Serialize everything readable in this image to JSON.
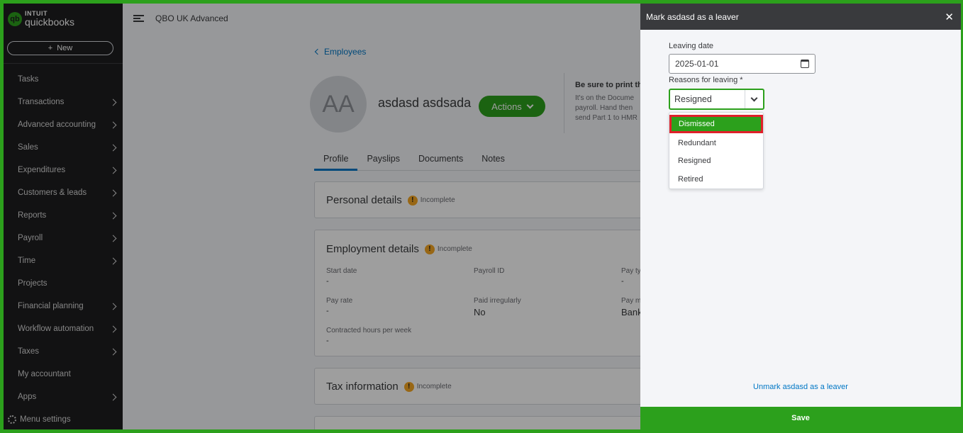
{
  "app": {
    "logo_top": "INTUIT",
    "logo_bottom": "quickbooks",
    "logo_mark": "qb",
    "company": "QBO UK Advanced",
    "new_label": "New",
    "brand_green": "#2ca01c",
    "sidebar_bg": "#1d1d1f"
  },
  "sidebar": {
    "items": [
      {
        "label": "Tasks",
        "chevron": false
      },
      {
        "label": "Transactions",
        "chevron": true
      },
      {
        "label": "Advanced accounting",
        "chevron": true
      },
      {
        "label": "Sales",
        "chevron": true
      },
      {
        "label": "Expenditures",
        "chevron": true
      },
      {
        "label": "Customers & leads",
        "chevron": true
      },
      {
        "label": "Reports",
        "chevron": true
      },
      {
        "label": "Payroll",
        "chevron": true
      },
      {
        "label": "Time",
        "chevron": true
      },
      {
        "label": "Projects",
        "chevron": false
      },
      {
        "label": "Financial planning",
        "chevron": true
      },
      {
        "label": "Workflow automation",
        "chevron": true
      },
      {
        "label": "Taxes",
        "chevron": true
      },
      {
        "label": "My accountant",
        "chevron": false
      },
      {
        "label": "Apps",
        "chevron": true
      }
    ],
    "menu_settings": "Menu settings"
  },
  "employee": {
    "back_label": "Employees",
    "initials": "AA",
    "name": "asdasd asdsada",
    "actions_label": "Actions",
    "notice_title": "Be sure to print th",
    "notice_body": "It's on the Docume\npayroll. Hand then\nsend Part 1 to HMR",
    "tabs": [
      "Profile",
      "Payslips",
      "Documents",
      "Notes"
    ],
    "active_tab": "Profile",
    "personal": {
      "title": "Personal details",
      "status": "Incomplete"
    },
    "employment": {
      "title": "Employment details",
      "status": "Incomplete",
      "start_date_label": "Start date",
      "start_date_value": "-",
      "payroll_id_label": "Payroll ID",
      "pay_type_label": "Pay ty",
      "pay_type_value": "-",
      "pay_rate_label": "Pay rate",
      "pay_rate_value": "-",
      "paid_irregularly_label": "Paid irregularly",
      "paid_irregularly_value": "No",
      "pay_method_label": "Pay m",
      "pay_method_value": "Bank",
      "contracted_label": "Contracted hours per week",
      "contracted_value": "-"
    },
    "tax": {
      "title": "Tax information",
      "status": "Incomplete"
    }
  },
  "drawer": {
    "title": "Mark asdasd as a leaver",
    "leaving_date_label": "Leaving date",
    "leaving_date_value": "2025-01-01",
    "reasons_label": "Reasons for leaving *",
    "reasons_value": "Resigned",
    "options": [
      "Dismissed",
      "Redundant",
      "Resigned",
      "Retired"
    ],
    "highlighted_option": "Dismissed",
    "unmark_label": "Unmark asdasd as a leaver",
    "save_label": "Save"
  }
}
